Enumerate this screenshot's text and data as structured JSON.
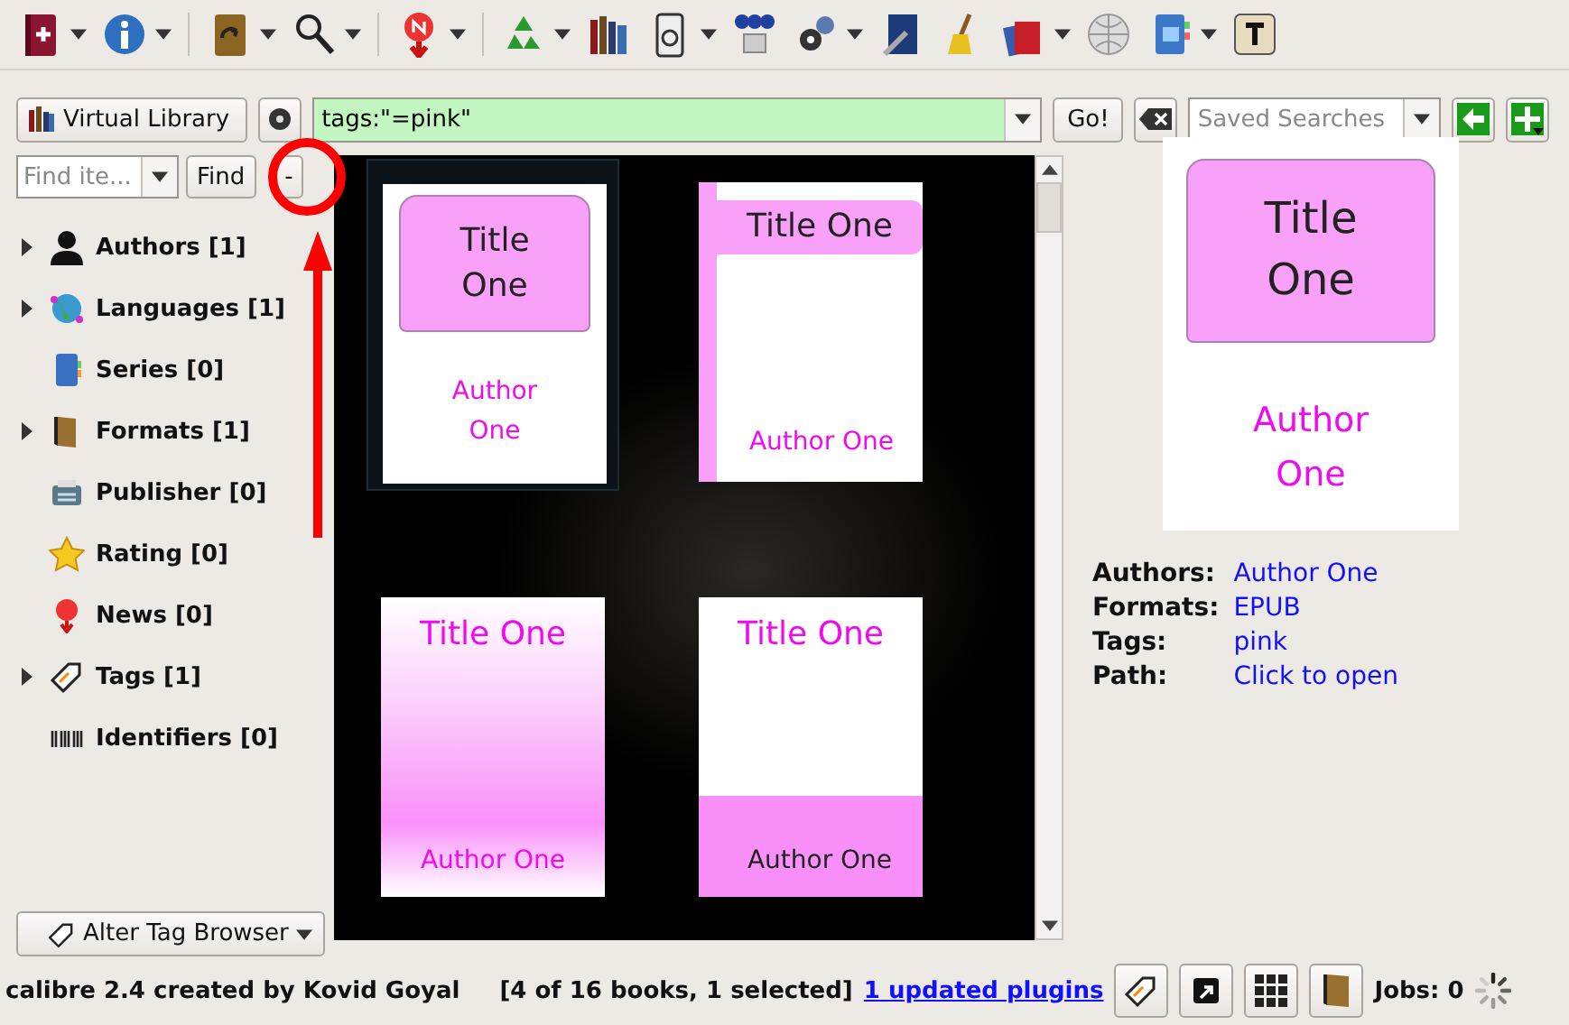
{
  "toolbar": [
    {
      "items": [
        {
          "menu": true
        },
        {
          "menu": true
        }
      ]
    },
    {
      "items": [
        {
          "menu": true
        },
        {
          "menu": true
        }
      ]
    },
    {
      "items": [
        {
          "menu": true
        }
      ]
    },
    {
      "items": [
        {
          "menu": true
        },
        {
          "menu": false
        },
        {
          "menu": true
        },
        {
          "menu": false
        },
        {
          "menu": true
        },
        {
          "menu": false
        },
        {
          "menu": false
        },
        {
          "menu": true
        },
        {
          "menu": false
        },
        {
          "menu": true
        },
        {
          "menu": false
        }
      ]
    }
  ],
  "search_bar": {
    "virtual_library": "Virtual Library",
    "query": "tags:\"=pink\"",
    "go": "Go!",
    "saved_searches": {
      "placeholder": "Saved Searches"
    }
  },
  "tag_browser": {
    "find": {
      "placeholder": "Find ite..."
    },
    "find_button": "Find",
    "collapse_button": "-",
    "items": [
      {
        "label": "Authors [1]",
        "expandable": true
      },
      {
        "label": "Languages [1]",
        "expandable": true
      },
      {
        "label": "Series [0]",
        "expandable": false
      },
      {
        "label": "Formats [1]",
        "expandable": true
      },
      {
        "label": "Publisher [0]",
        "expandable": false
      },
      {
        "label": "Rating [0]",
        "expandable": false
      },
      {
        "label": "News [0]",
        "expandable": false
      },
      {
        "label": "Tags [1]",
        "expandable": true
      },
      {
        "label": "Identifiers [0]",
        "expandable": false
      }
    ],
    "alter_button": "Alter Tag Browser"
  },
  "cover_grid": [
    {
      "kind": "banner",
      "title": "Title One",
      "author": "Author One",
      "selected": true
    },
    {
      "kind": "side",
      "title": "Title One",
      "author": "Author One",
      "selected": false
    },
    {
      "kind": "gradient",
      "title": "Title One",
      "author": "Author One",
      "selected": false
    },
    {
      "kind": "block",
      "title": "Title One",
      "author": "Author One",
      "selected": false
    }
  ],
  "details": {
    "cover": {
      "kind": "banner",
      "title": "Title One",
      "author": "Author One"
    },
    "rows": [
      {
        "label": "Authors:",
        "value": "Author One"
      },
      {
        "label": "Formats:",
        "value": "EPUB"
      },
      {
        "label": "Tags:",
        "value": "pink"
      },
      {
        "label": "Path:",
        "value": "Click to open"
      }
    ]
  },
  "status_bar": {
    "credit": "calibre 2.4 created by Kovid Goyal",
    "count": "[4 of 16 books, 1 selected]",
    "link": "1 updated plugins",
    "jobs": "Jobs: 0"
  }
}
